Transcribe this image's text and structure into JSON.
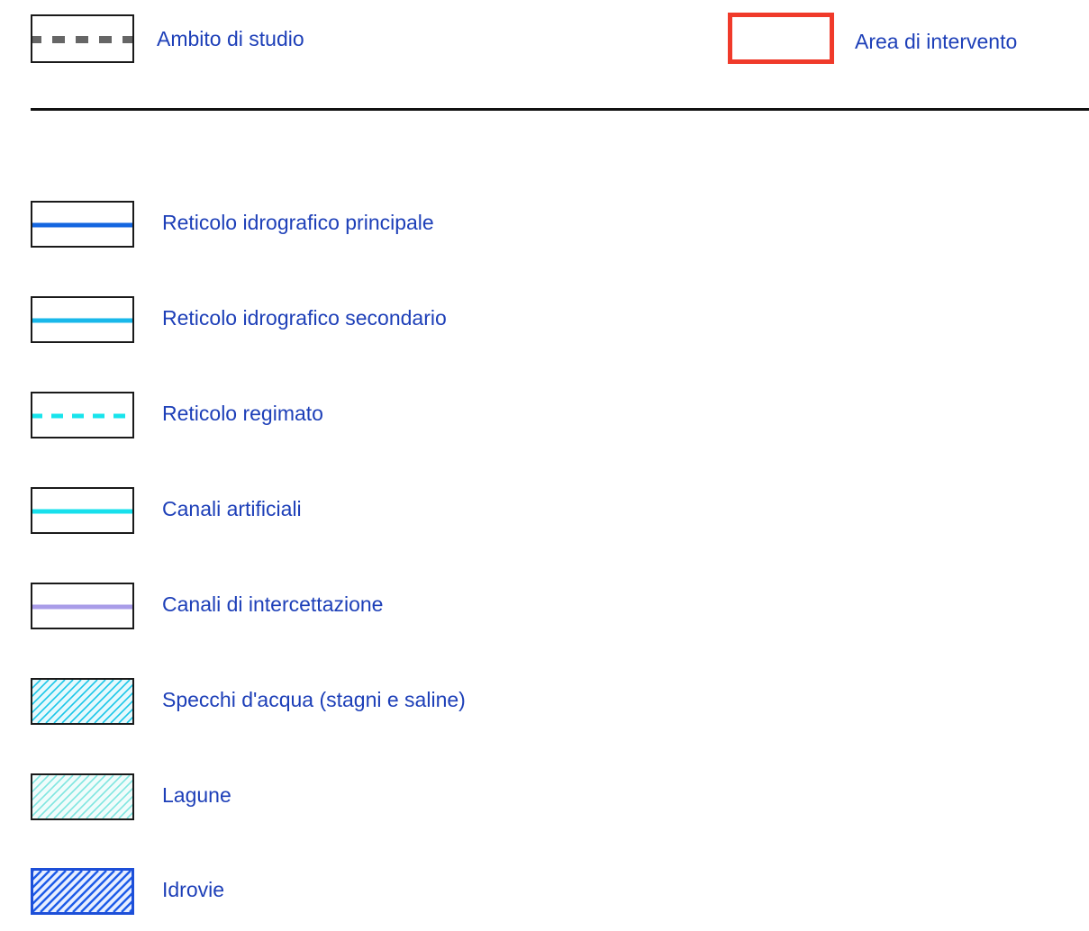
{
  "header": {
    "ambito": {
      "label": "Ambito di studio",
      "line_color": "#666666",
      "line_style": "dashed"
    },
    "area": {
      "label": "Area di intervento",
      "border_color": "#f03a2a"
    }
  },
  "legend": {
    "items": [
      {
        "label": "Reticolo idrografico principale",
        "symbol": "line",
        "color": "#1466e0",
        "style": "solid"
      },
      {
        "label": "Reticolo idrografico secondario",
        "symbol": "line",
        "color": "#19b8ea",
        "style": "solid"
      },
      {
        "label": "Reticolo regimato",
        "symbol": "line",
        "color": "#18e4ec",
        "style": "dashed"
      },
      {
        "label": "Canali artificiali",
        "symbol": "line",
        "color": "#18e0ec",
        "style": "solid"
      },
      {
        "label": "Canali di intercettazione",
        "symbol": "line",
        "color": "#a99ce8",
        "style": "solid"
      },
      {
        "label": "Specchi d'acqua (stagni e saline)",
        "symbol": "hatch",
        "color": "#19c6e8",
        "fill": "#e6f9fd"
      },
      {
        "label": "Lagune",
        "symbol": "hatch",
        "color": "#7fe6e0",
        "fill": "#f0fcfb"
      },
      {
        "label": "Idrovie",
        "symbol": "hatch",
        "color": "#1d5be8",
        "fill": "#e8efff"
      }
    ]
  }
}
